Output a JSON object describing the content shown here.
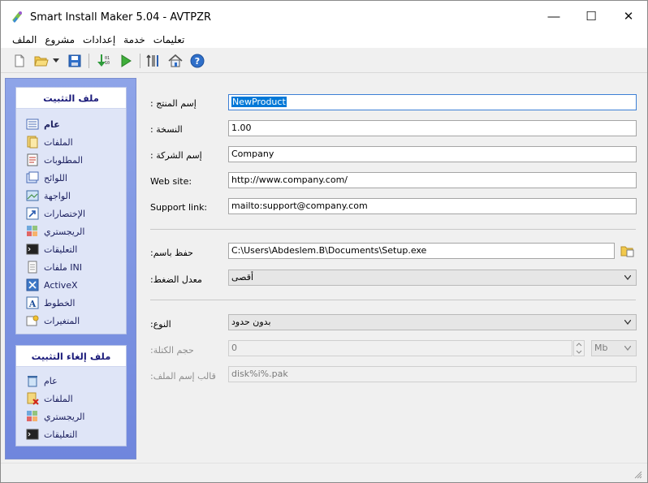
{
  "window": {
    "title": "Smart Install Maker 5.04 - AVTPZR",
    "minimize": "—",
    "maximize": "☐",
    "close": "✕"
  },
  "menu": [
    "الملف",
    "مشروع",
    "إعدادات",
    "خدمة",
    "تعليمات"
  ],
  "toolbar": {
    "icons": [
      "new-file-icon",
      "open-folder-icon",
      "dropdown-arrow-icon",
      "save-icon",
      "build-icon",
      "run-icon",
      "settings-tools-icon",
      "home-icon",
      "help-icon"
    ]
  },
  "sidebar": {
    "install_panel": {
      "title": "ملف التثبيت",
      "items": [
        {
          "label": "عام",
          "icon": "general-list-icon",
          "active": true
        },
        {
          "label": "الملفات",
          "icon": "files-icon"
        },
        {
          "label": "المطلوبات",
          "icon": "requirements-icon"
        },
        {
          "label": "اللوائح",
          "icon": "dialogs-icon"
        },
        {
          "label": "الواجهة",
          "icon": "interface-icon"
        },
        {
          "label": "الإختصارات",
          "icon": "shortcut-icon"
        },
        {
          "label": "الريجستري",
          "icon": "registry-icon"
        },
        {
          "label": "التعليقات",
          "icon": "commands-icon"
        },
        {
          "label": "ملفات INI",
          "icon": "ini-file-icon"
        },
        {
          "label": "ActiveX",
          "icon": "activex-icon"
        },
        {
          "label": "الخطوط",
          "icon": "fonts-icon"
        },
        {
          "label": "المتغيرات",
          "icon": "variables-icon"
        }
      ]
    },
    "uninstall_panel": {
      "title": "ملف إلغاء التثبيت",
      "items": [
        {
          "label": "عام",
          "icon": "trash-icon"
        },
        {
          "label": "الملفات",
          "icon": "delete-files-icon"
        },
        {
          "label": "الريجستري",
          "icon": "registry-icon"
        },
        {
          "label": "التعليقات",
          "icon": "commands-icon"
        }
      ]
    }
  },
  "form": {
    "product_name": {
      "label": ": إسم المنتج",
      "value": "NewProduct"
    },
    "version": {
      "label": ": النسخة",
      "value": "1.00"
    },
    "company": {
      "label": ": إسم الشركة",
      "value": "Company"
    },
    "website": {
      "label": "Web site:",
      "value": "http://www.company.com/"
    },
    "support": {
      "label": "Support link:",
      "value": "mailto:support@company.com"
    },
    "save_as": {
      "label": ":حفظ باسم",
      "value": "C:\\Users\\Abdeslem.B\\Documents\\Setup.exe"
    },
    "compression": {
      "label": ":معدل الضغط",
      "value": "أقصى"
    },
    "type": {
      "label": ":النوع",
      "value": "بدون حدود"
    },
    "block_size": {
      "label": ":حجم الكتلة",
      "value": "0",
      "unit": "Mb"
    },
    "filename_template": {
      "label": ":قالب إسم الملف",
      "value": "disk%i%.pak"
    }
  }
}
